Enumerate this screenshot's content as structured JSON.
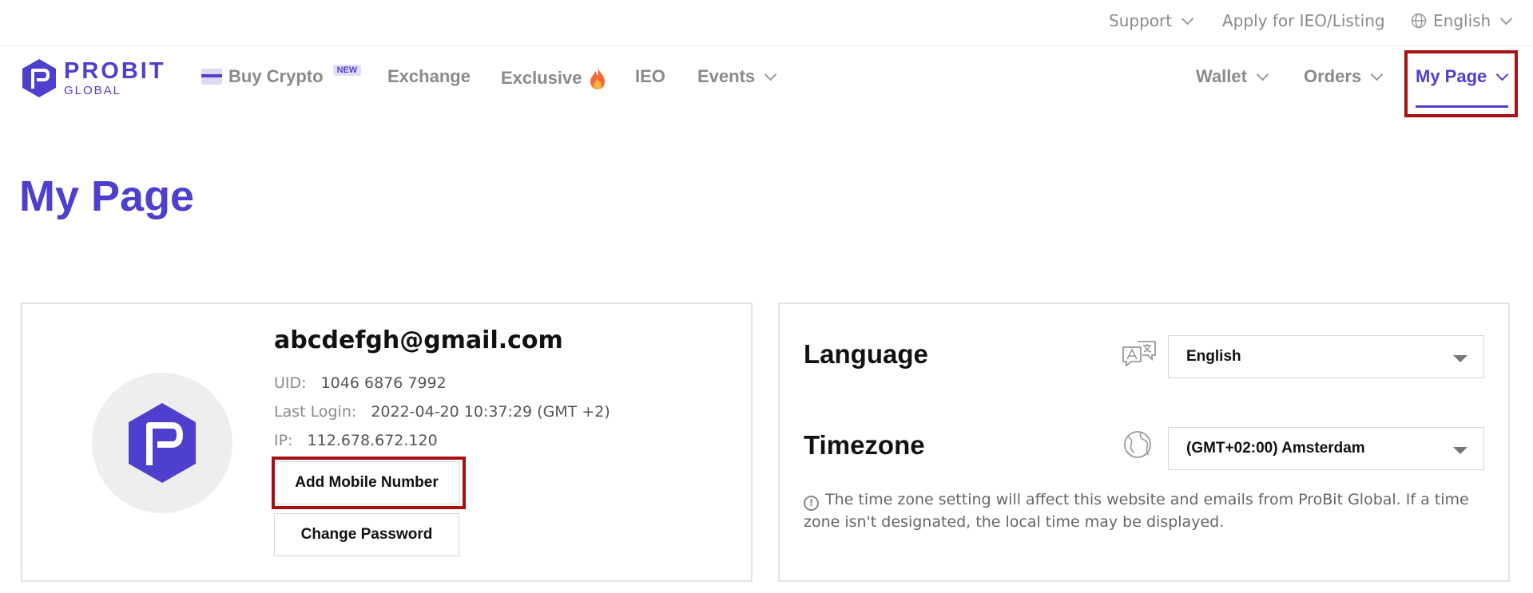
{
  "topbar": {
    "support": "Support",
    "apply": "Apply for IEO/Listing",
    "language": "English"
  },
  "nav": {
    "logo_main": "PROBIT",
    "logo_sub": "GLOBAL",
    "buy_crypto": "Buy Crypto",
    "new_badge": "NEW",
    "exchange": "Exchange",
    "exclusive": "Exclusive",
    "ieo": "IEO",
    "events": "Events",
    "wallet": "Wallet",
    "orders": "Orders",
    "my_page": "My Page"
  },
  "page": {
    "title": "My Page"
  },
  "profile": {
    "email": "abcdefgh@gmail.com",
    "uid_label": "UID:",
    "uid": "1046 6876 7992",
    "last_login_label": "Last Login:",
    "last_login": "2022-04-20 10:37:29 (GMT +2)",
    "ip_label": "IP:",
    "ip": "112.678.672.120",
    "add_mobile": "Add Mobile Number",
    "change_password": "Change Password"
  },
  "settings": {
    "language_label": "Language",
    "language_value": "English",
    "timezone_label": "Timezone",
    "timezone_value": "(GMT+02:00) Amsterdam",
    "note": "The time zone setting will affect this website and emails from ProBit Global. If a time zone isn't designated, the local time may be displayed."
  },
  "colors": {
    "brand": "#4f3fcf",
    "highlight": "#a80f0f"
  }
}
